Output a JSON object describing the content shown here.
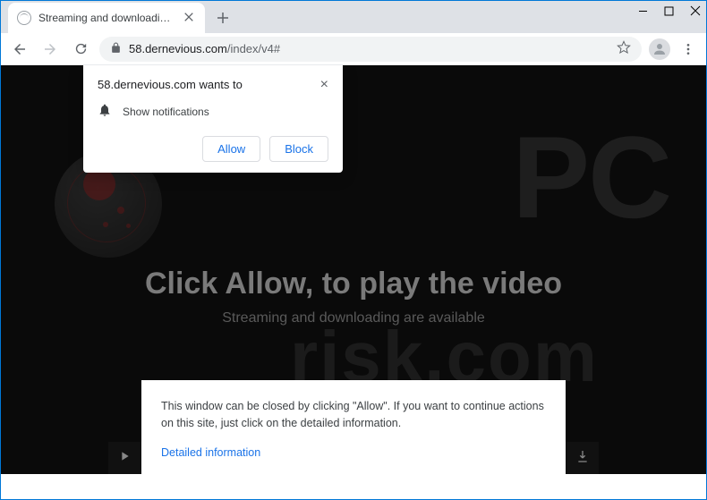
{
  "tab": {
    "title": "Streaming and downloading are"
  },
  "url": {
    "host": "58.dernevious.com",
    "path": "/index/v4#"
  },
  "permission": {
    "origin": "58.dernevious.com wants to",
    "capability": "Show notifications",
    "allow": "Allow",
    "block": "Block"
  },
  "page": {
    "headline": "Click Allow, to play the video",
    "subhead": "Streaming and downloading are available"
  },
  "card": {
    "text": "This window can be closed by clicking \"Allow\". If you want to continue actions on this site, just click on the detailed information.",
    "link": "Detailed information"
  },
  "watermark": {
    "top": "PC",
    "bottom": "risk.com"
  }
}
